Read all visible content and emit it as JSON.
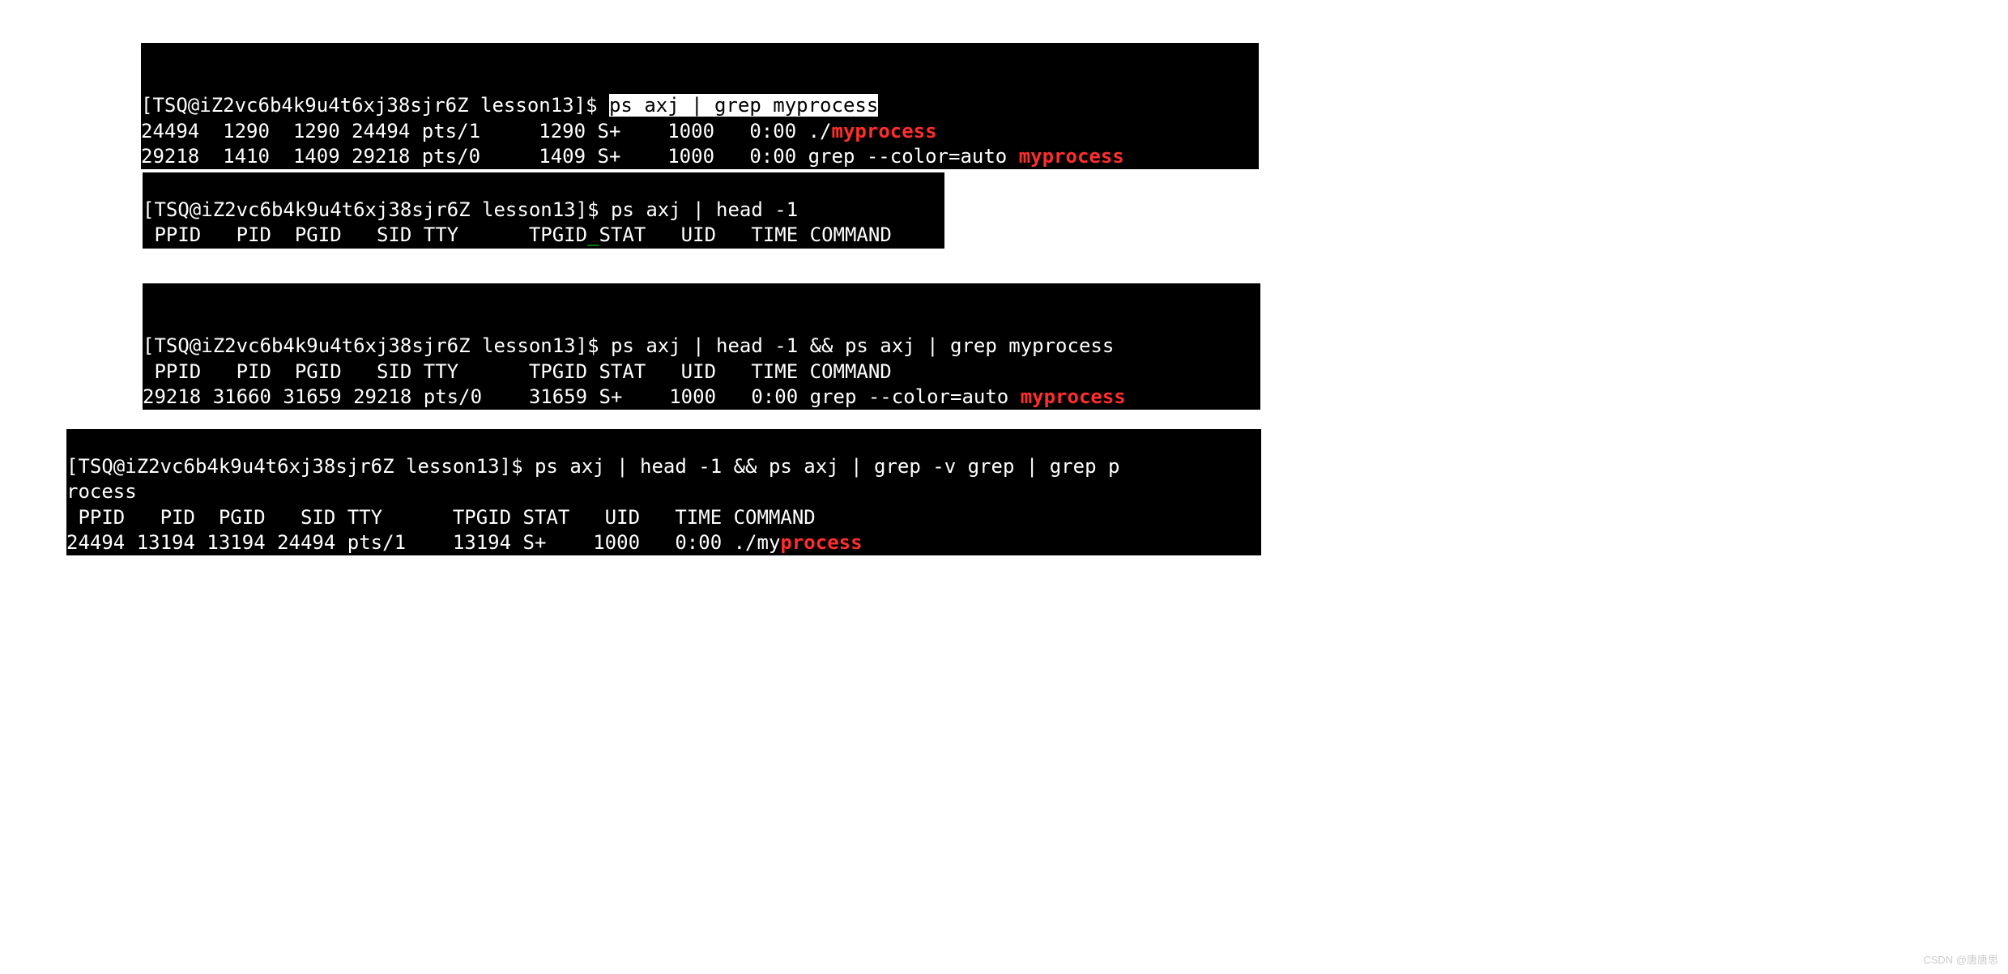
{
  "block1": {
    "prompt": "[TSQ@iZ2vc6b4k9u4t6xj38sjr6Z lesson13]$ ",
    "cmd_highlight": "ps axj | grep myprocess",
    "row1_a": "24494  1290  1290 24494 pts/1     1290 S+    1000   0:00 ./",
    "row1_b": "myprocess",
    "row2_a": "29218  1410  1409 29218 pts/0     1409 S+    1000   0:00 grep --color=auto ",
    "row2_b": "myprocess"
  },
  "block2": {
    "prompt": "[TSQ@iZ2vc6b4k9u4t6xj38sjr6Z lesson13]$ ",
    "cmd": "ps axj | head -1",
    "hdr_a": " PPID   PID  PGID   SID TTY      TPGID",
    "hdr_b": "_",
    "hdr_c": "STAT   UID   TIME COMMAND"
  },
  "block3": {
    "prompt": "[TSQ@iZ2vc6b4k9u4t6xj38sjr6Z lesson13]$ ",
    "cmd": "ps axj | head -1 && ps axj | grep myprocess",
    "header": " PPID   PID  PGID   SID TTY      TPGID STAT   UID   TIME COMMAND",
    "row_a": "29218 31660 31659 29218 pts/0    31659 S+    1000   0:00 grep --color=auto ",
    "row_b": "myprocess"
  },
  "block4": {
    "prompt": "[TSQ@iZ2vc6b4k9u4t6xj38sjr6Z lesson13]$ ",
    "cmd_line1": "ps axj | head -1 && ps axj | grep -v grep | grep p",
    "cmd_line2": "rocess",
    "header": " PPID   PID  PGID   SID TTY      TPGID STAT   UID   TIME COMMAND",
    "row_a": "24494 13194 13194 24494 pts/1    13194 S+    1000   0:00 ./my",
    "row_b": "process"
  },
  "watermark": "CSDN @唐唐思"
}
